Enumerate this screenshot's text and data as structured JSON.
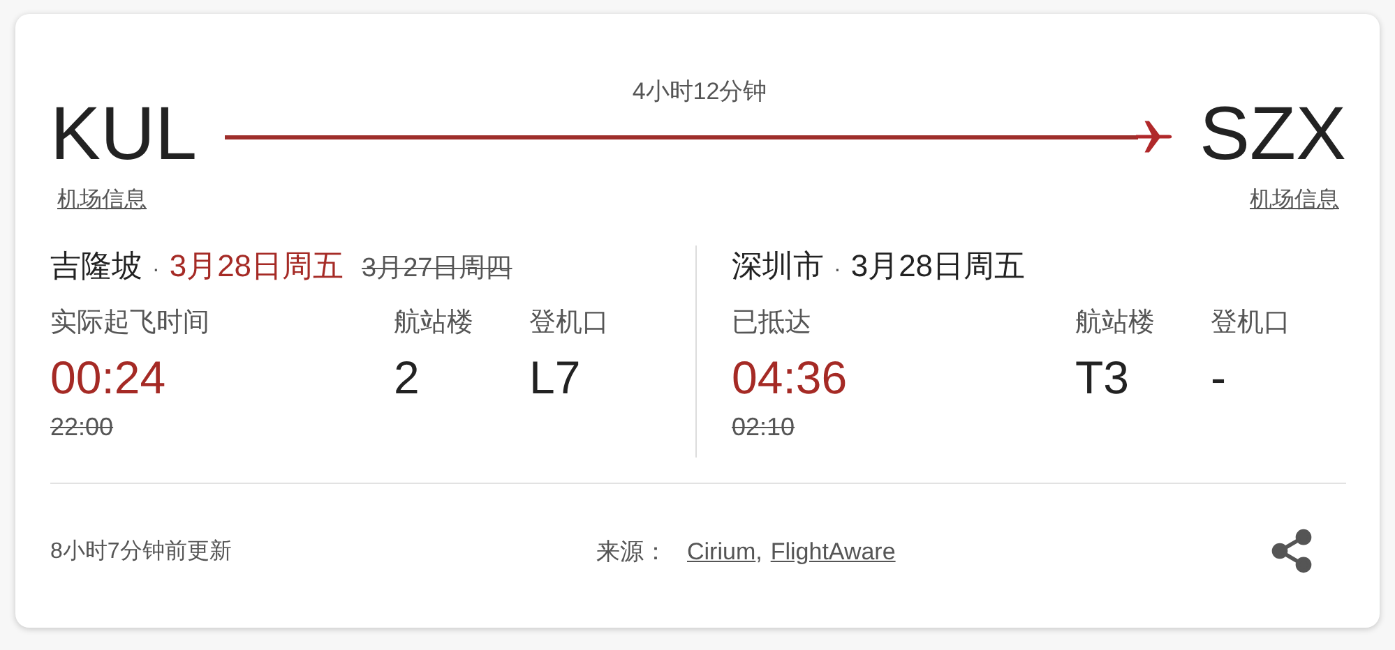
{
  "duration": "4小时12分钟",
  "origin": {
    "code": "KUL",
    "airport_link": "机场信息"
  },
  "destination": {
    "code": "SZX",
    "airport_link": "机场信息"
  },
  "legs": [
    {
      "city": "吉隆坡",
      "separator": "·",
      "date": "3月28日周五",
      "date_changed": true,
      "old_date": "3月27日周四",
      "status_label": "实际起飞时间",
      "time": "00:24",
      "time_changed": true,
      "old_time": "22:00",
      "terminal_label": "航站楼",
      "terminal": "2",
      "gate_label": "登机口",
      "gate": "L7"
    },
    {
      "city": "深圳市",
      "separator": "·",
      "date": "3月28日周五",
      "date_changed": false,
      "status_label": "已抵达",
      "time": "04:36",
      "time_changed": true,
      "old_time": "02:10",
      "terminal_label": "航站楼",
      "terminal": "T3",
      "gate_label": "登机口",
      "gate": "-"
    }
  ],
  "footer": {
    "updated": "8小时7分钟前更新",
    "source_label": "来源：",
    "sources": [
      "Cirium",
      "FlightAware"
    ],
    "source_separator": ","
  }
}
